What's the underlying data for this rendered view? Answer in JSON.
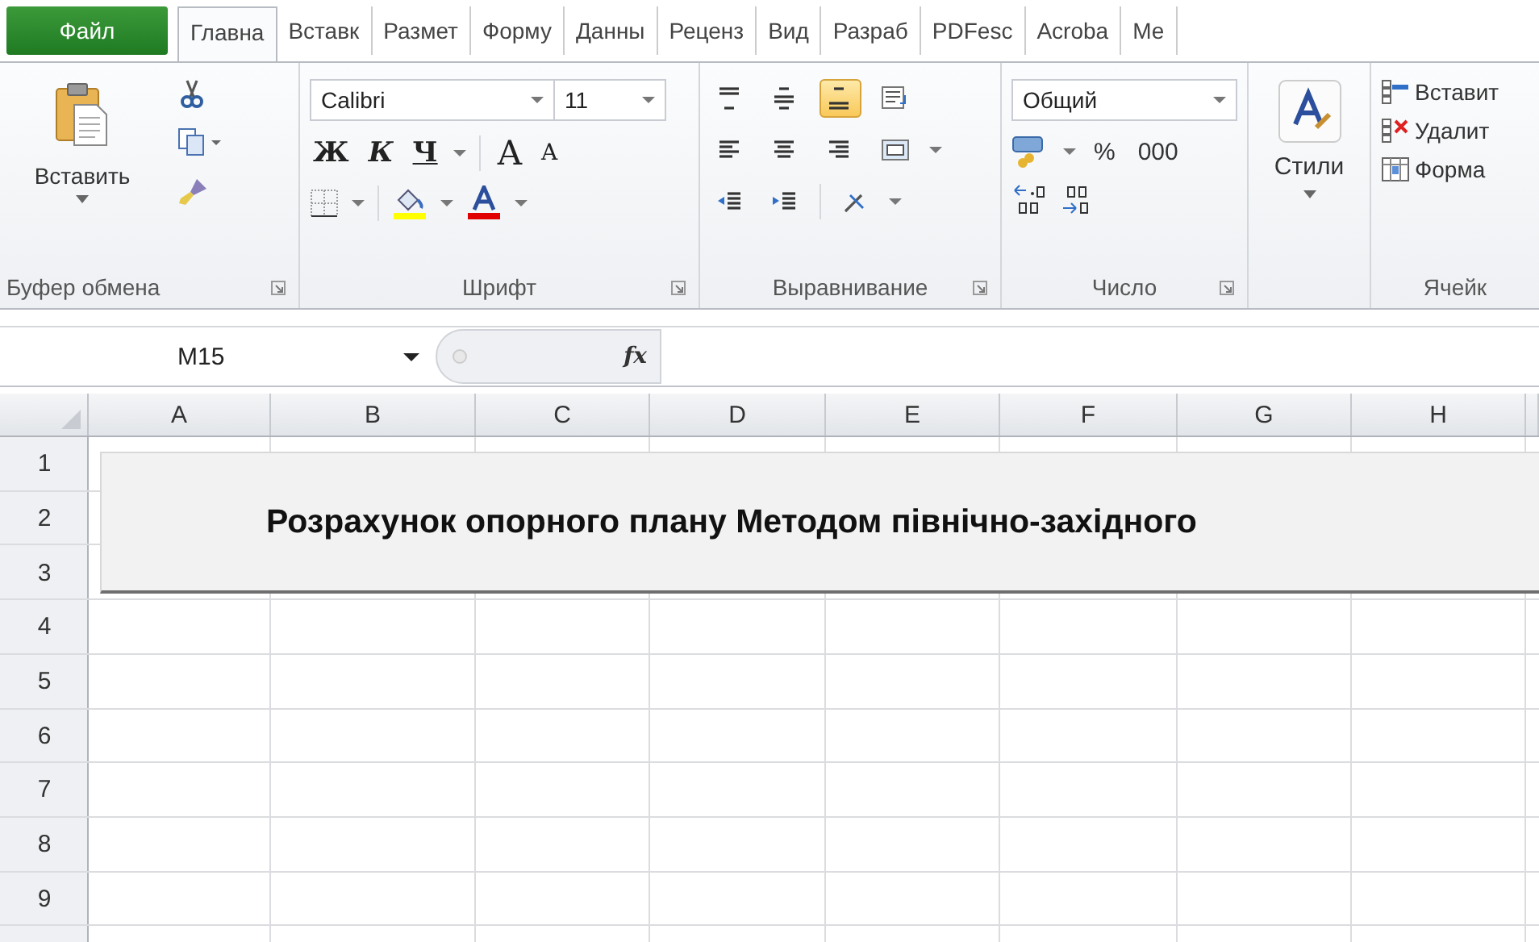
{
  "file_tab": {
    "label": "Файл"
  },
  "tabs": [
    {
      "label": "Главна",
      "selected": true
    },
    {
      "label": "Вставк",
      "selected": false
    },
    {
      "label": "Размет",
      "selected": false
    },
    {
      "label": "Форму",
      "selected": false
    },
    {
      "label": "Данны",
      "selected": false
    },
    {
      "label": "Реценз",
      "selected": false
    },
    {
      "label": "Вид",
      "selected": false
    },
    {
      "label": "Разраб",
      "selected": false
    },
    {
      "label": "PDFesc",
      "selected": false
    },
    {
      "label": "Acroba",
      "selected": false
    },
    {
      "label": "Ме",
      "selected": false
    }
  ],
  "clipboard": {
    "paste": "Вставить",
    "group": "Буфер обмена"
  },
  "font": {
    "name": "Calibri",
    "size": "11",
    "bold": "Ж",
    "italic": "К",
    "underline": "Ч",
    "grow": "A",
    "shrink": "A",
    "group": "Шрифт"
  },
  "alignment": {
    "group": "Выравнивание",
    "buttons": [
      {
        "kind": "top",
        "selected": false
      },
      {
        "kind": "middle",
        "selected": false
      },
      {
        "kind": "bottom",
        "selected": true
      },
      {
        "kind": "wrap",
        "selected": false
      },
      {
        "kind": "left",
        "selected": false
      },
      {
        "kind": "center",
        "selected": false
      },
      {
        "kind": "right",
        "selected": false
      },
      {
        "kind": "merge",
        "selected": false
      },
      {
        "kind": "outdent",
        "selected": false
      },
      {
        "kind": "indent",
        "selected": false
      },
      {
        "kind": "orientation",
        "selected": false
      }
    ]
  },
  "number": {
    "format": "Общий",
    "percent": "%",
    "thousands": "000",
    "group": "Число"
  },
  "styles": {
    "label": "Стили"
  },
  "cells": {
    "insert": "Вставит",
    "delete": "Удалит",
    "format": "Форма",
    "group": "Ячейк"
  },
  "formula_bar": {
    "name_box": "M15",
    "function_label": "fx"
  },
  "columns": [
    "A",
    "B",
    "C",
    "D",
    "E",
    "F",
    "G",
    "H"
  ],
  "rows": [
    "1",
    "2",
    "3",
    "4",
    "5",
    "6",
    "7",
    "8",
    "9"
  ],
  "banner": {
    "title": "Розрахунок опорного плану Методом північно-західного"
  }
}
